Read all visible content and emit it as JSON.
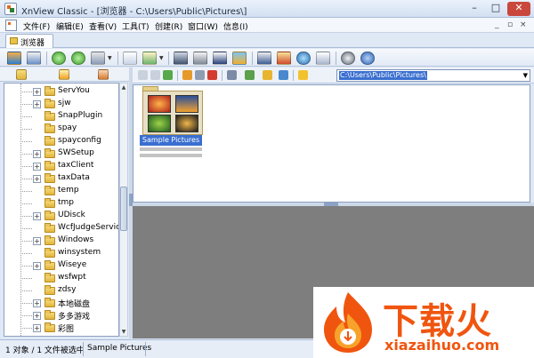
{
  "window": {
    "title": "XnView Classic - [浏览器 - C:\\Users\\Public\\Pictures\\]",
    "minimize": "–",
    "maximize": "□",
    "close": "✕"
  },
  "menu": {
    "items": [
      "文件(F)",
      "编辑(E)",
      "查看(V)",
      "工具(T)",
      "创建(R)",
      "窗口(W)",
      "信息(I)"
    ],
    "mdi_controls": [
      "_",
      "▫",
      "×"
    ]
  },
  "tabs": [
    {
      "label": "浏览器"
    }
  ],
  "address_bar": {
    "value": "C:\\Users\\Public\\Pictures\\"
  },
  "tree": {
    "items": [
      {
        "label": "ServYou",
        "expandable": true
      },
      {
        "label": "sjw",
        "expandable": true
      },
      {
        "label": "SnapPlugin",
        "expandable": false
      },
      {
        "label": "spay",
        "expandable": false
      },
      {
        "label": "spayconfig",
        "expandable": false
      },
      {
        "label": "SWSetup",
        "expandable": true
      },
      {
        "label": "taxClient",
        "expandable": true
      },
      {
        "label": "taxData",
        "expandable": true
      },
      {
        "label": "temp",
        "expandable": false
      },
      {
        "label": "tmp",
        "expandable": false
      },
      {
        "label": "UDisck",
        "expandable": true
      },
      {
        "label": "WcfJudgeService",
        "expandable": false
      },
      {
        "label": "Windows",
        "expandable": true
      },
      {
        "label": "winsystem",
        "expandable": false
      },
      {
        "label": "Wiseye",
        "expandable": true
      },
      {
        "label": "wsfwpt",
        "expandable": false
      },
      {
        "label": "zdsy",
        "expandable": false
      },
      {
        "label": "本地磁盘",
        "expandable": true
      },
      {
        "label": "多多游戏",
        "expandable": true
      },
      {
        "label": "彩图",
        "expandable": true
      }
    ]
  },
  "browser": {
    "items": [
      {
        "name": "Sample Pictures"
      }
    ]
  },
  "status": {
    "objects": "1 对象 / 1 文件被选中",
    "selection": "Sample Pictures"
  },
  "watermark": {
    "title": "下载火",
    "subtitle": "xiazaihuo.com"
  },
  "colors": {
    "selection": "#3a6fd0",
    "brand": "#f0550f",
    "preview_bg": "#7e7e7e"
  }
}
